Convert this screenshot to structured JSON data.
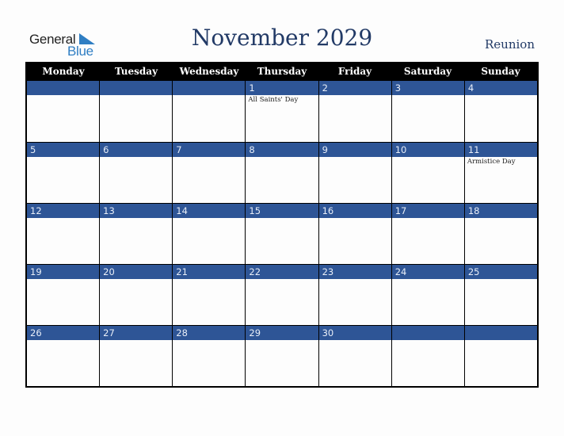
{
  "logo": {
    "word1": "General",
    "word2": "Blue",
    "accent_color": "#2f7ec3"
  },
  "header": {
    "title": "November 2029",
    "region": "Reunion"
  },
  "colors": {
    "header_bg": "#000000",
    "date_band": "#2e5596",
    "title": "#223a66"
  },
  "weekdays": [
    "Monday",
    "Tuesday",
    "Wednesday",
    "Thursday",
    "Friday",
    "Saturday",
    "Sunday"
  ],
  "weeks": [
    [
      {
        "date": "",
        "event": ""
      },
      {
        "date": "",
        "event": ""
      },
      {
        "date": "",
        "event": ""
      },
      {
        "date": "1",
        "event": "All Saints' Day"
      },
      {
        "date": "2",
        "event": ""
      },
      {
        "date": "3",
        "event": ""
      },
      {
        "date": "4",
        "event": ""
      }
    ],
    [
      {
        "date": "5",
        "event": ""
      },
      {
        "date": "6",
        "event": ""
      },
      {
        "date": "7",
        "event": ""
      },
      {
        "date": "8",
        "event": ""
      },
      {
        "date": "9",
        "event": ""
      },
      {
        "date": "10",
        "event": ""
      },
      {
        "date": "11",
        "event": "Armistice Day"
      }
    ],
    [
      {
        "date": "12",
        "event": ""
      },
      {
        "date": "13",
        "event": ""
      },
      {
        "date": "14",
        "event": ""
      },
      {
        "date": "15",
        "event": ""
      },
      {
        "date": "16",
        "event": ""
      },
      {
        "date": "17",
        "event": ""
      },
      {
        "date": "18",
        "event": ""
      }
    ],
    [
      {
        "date": "19",
        "event": ""
      },
      {
        "date": "20",
        "event": ""
      },
      {
        "date": "21",
        "event": ""
      },
      {
        "date": "22",
        "event": ""
      },
      {
        "date": "23",
        "event": ""
      },
      {
        "date": "24",
        "event": ""
      },
      {
        "date": "25",
        "event": ""
      }
    ],
    [
      {
        "date": "26",
        "event": ""
      },
      {
        "date": "27",
        "event": ""
      },
      {
        "date": "28",
        "event": ""
      },
      {
        "date": "29",
        "event": ""
      },
      {
        "date": "30",
        "event": ""
      },
      {
        "date": "",
        "event": ""
      },
      {
        "date": "",
        "event": ""
      }
    ]
  ]
}
